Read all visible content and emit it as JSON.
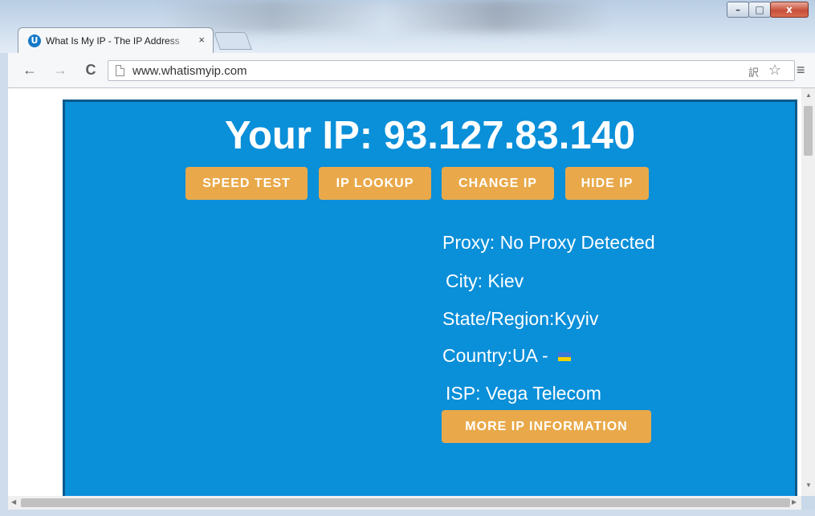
{
  "browser": {
    "tab_title": "What Is My IP - The IP Address",
    "tab_close": "×",
    "url": "www.whatismyip.com",
    "window_controls": {
      "minimize": "–",
      "maximize": "□",
      "close": "x"
    }
  },
  "page": {
    "headline": "Your IP: 93.127.83.140",
    "buttons": [
      "SPEED TEST",
      "IP LOOKUP",
      "CHANGE IP",
      "HIDE IP"
    ],
    "info": {
      "proxy_label": "Proxy:",
      "proxy_value": "No Proxy Detected",
      "city_label": "City:",
      "city_value": "Kiev",
      "state_label": "State/Region:",
      "state_value": "Kyyiv",
      "country_label": "Country:",
      "country_value": "UA -",
      "isp_label": "ISP:",
      "isp_value": "Vega Telecom"
    },
    "more_button": "MORE IP INFORMATION"
  },
  "colors": {
    "panel_bg": "#0a8fd9",
    "button_bg": "#e9a94a",
    "text": "#ffffff",
    "flag_top": "#3a78d8",
    "flag_bottom": "#f5d200"
  }
}
